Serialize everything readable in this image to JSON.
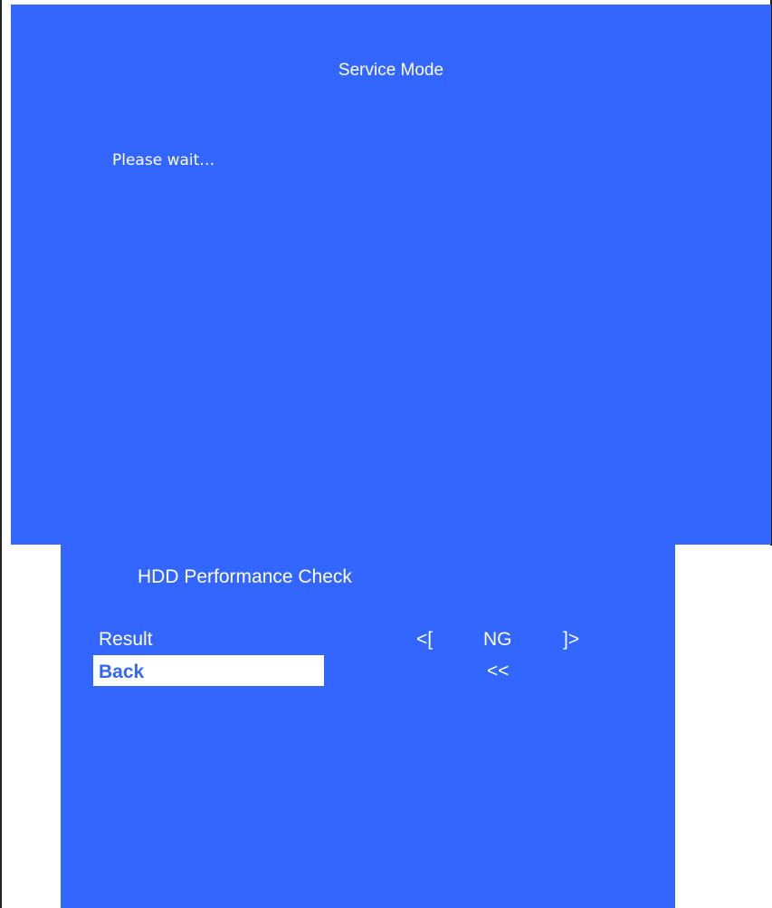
{
  "header": {
    "title": "Service Mode",
    "status": "Please wait…"
  },
  "panel": {
    "title": "HDD Performance Check",
    "rows": [
      {
        "label": "Result",
        "value_open": "<[",
        "value": "NG",
        "value_close": "]>"
      },
      {
        "label": "Back",
        "value": "<<",
        "selected": true
      }
    ]
  },
  "colors": {
    "screen_background": "#3366ff",
    "text": "#ffffff",
    "selection_background": "#ffffff",
    "selection_text": "#3366ff"
  }
}
